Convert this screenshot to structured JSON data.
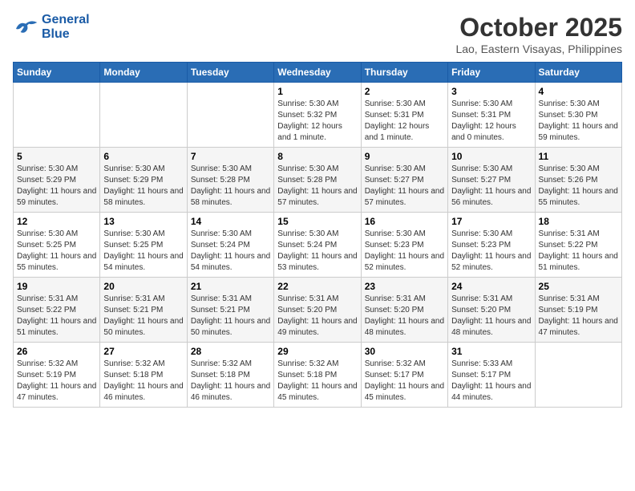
{
  "logo": {
    "line1": "General",
    "line2": "Blue"
  },
  "title": "October 2025",
  "location": "Lao, Eastern Visayas, Philippines",
  "weekdays": [
    "Sunday",
    "Monday",
    "Tuesday",
    "Wednesday",
    "Thursday",
    "Friday",
    "Saturday"
  ],
  "weeks": [
    [
      {
        "day": "",
        "sunrise": "",
        "sunset": "",
        "daylight": ""
      },
      {
        "day": "",
        "sunrise": "",
        "sunset": "",
        "daylight": ""
      },
      {
        "day": "",
        "sunrise": "",
        "sunset": "",
        "daylight": ""
      },
      {
        "day": "1",
        "sunrise": "Sunrise: 5:30 AM",
        "sunset": "Sunset: 5:32 PM",
        "daylight": "Daylight: 12 hours and 1 minute."
      },
      {
        "day": "2",
        "sunrise": "Sunrise: 5:30 AM",
        "sunset": "Sunset: 5:31 PM",
        "daylight": "Daylight: 12 hours and 1 minute."
      },
      {
        "day": "3",
        "sunrise": "Sunrise: 5:30 AM",
        "sunset": "Sunset: 5:31 PM",
        "daylight": "Daylight: 12 hours and 0 minutes."
      },
      {
        "day": "4",
        "sunrise": "Sunrise: 5:30 AM",
        "sunset": "Sunset: 5:30 PM",
        "daylight": "Daylight: 11 hours and 59 minutes."
      }
    ],
    [
      {
        "day": "5",
        "sunrise": "Sunrise: 5:30 AM",
        "sunset": "Sunset: 5:29 PM",
        "daylight": "Daylight: 11 hours and 59 minutes."
      },
      {
        "day": "6",
        "sunrise": "Sunrise: 5:30 AM",
        "sunset": "Sunset: 5:29 PM",
        "daylight": "Daylight: 11 hours and 58 minutes."
      },
      {
        "day": "7",
        "sunrise": "Sunrise: 5:30 AM",
        "sunset": "Sunset: 5:28 PM",
        "daylight": "Daylight: 11 hours and 58 minutes."
      },
      {
        "day": "8",
        "sunrise": "Sunrise: 5:30 AM",
        "sunset": "Sunset: 5:28 PM",
        "daylight": "Daylight: 11 hours and 57 minutes."
      },
      {
        "day": "9",
        "sunrise": "Sunrise: 5:30 AM",
        "sunset": "Sunset: 5:27 PM",
        "daylight": "Daylight: 11 hours and 57 minutes."
      },
      {
        "day": "10",
        "sunrise": "Sunrise: 5:30 AM",
        "sunset": "Sunset: 5:27 PM",
        "daylight": "Daylight: 11 hours and 56 minutes."
      },
      {
        "day": "11",
        "sunrise": "Sunrise: 5:30 AM",
        "sunset": "Sunset: 5:26 PM",
        "daylight": "Daylight: 11 hours and 55 minutes."
      }
    ],
    [
      {
        "day": "12",
        "sunrise": "Sunrise: 5:30 AM",
        "sunset": "Sunset: 5:25 PM",
        "daylight": "Daylight: 11 hours and 55 minutes."
      },
      {
        "day": "13",
        "sunrise": "Sunrise: 5:30 AM",
        "sunset": "Sunset: 5:25 PM",
        "daylight": "Daylight: 11 hours and 54 minutes."
      },
      {
        "day": "14",
        "sunrise": "Sunrise: 5:30 AM",
        "sunset": "Sunset: 5:24 PM",
        "daylight": "Daylight: 11 hours and 54 minutes."
      },
      {
        "day": "15",
        "sunrise": "Sunrise: 5:30 AM",
        "sunset": "Sunset: 5:24 PM",
        "daylight": "Daylight: 11 hours and 53 minutes."
      },
      {
        "day": "16",
        "sunrise": "Sunrise: 5:30 AM",
        "sunset": "Sunset: 5:23 PM",
        "daylight": "Daylight: 11 hours and 52 minutes."
      },
      {
        "day": "17",
        "sunrise": "Sunrise: 5:30 AM",
        "sunset": "Sunset: 5:23 PM",
        "daylight": "Daylight: 11 hours and 52 minutes."
      },
      {
        "day": "18",
        "sunrise": "Sunrise: 5:31 AM",
        "sunset": "Sunset: 5:22 PM",
        "daylight": "Daylight: 11 hours and 51 minutes."
      }
    ],
    [
      {
        "day": "19",
        "sunrise": "Sunrise: 5:31 AM",
        "sunset": "Sunset: 5:22 PM",
        "daylight": "Daylight: 11 hours and 51 minutes."
      },
      {
        "day": "20",
        "sunrise": "Sunrise: 5:31 AM",
        "sunset": "Sunset: 5:21 PM",
        "daylight": "Daylight: 11 hours and 50 minutes."
      },
      {
        "day": "21",
        "sunrise": "Sunrise: 5:31 AM",
        "sunset": "Sunset: 5:21 PM",
        "daylight": "Daylight: 11 hours and 50 minutes."
      },
      {
        "day": "22",
        "sunrise": "Sunrise: 5:31 AM",
        "sunset": "Sunset: 5:20 PM",
        "daylight": "Daylight: 11 hours and 49 minutes."
      },
      {
        "day": "23",
        "sunrise": "Sunrise: 5:31 AM",
        "sunset": "Sunset: 5:20 PM",
        "daylight": "Daylight: 11 hours and 48 minutes."
      },
      {
        "day": "24",
        "sunrise": "Sunrise: 5:31 AM",
        "sunset": "Sunset: 5:20 PM",
        "daylight": "Daylight: 11 hours and 48 minutes."
      },
      {
        "day": "25",
        "sunrise": "Sunrise: 5:31 AM",
        "sunset": "Sunset: 5:19 PM",
        "daylight": "Daylight: 11 hours and 47 minutes."
      }
    ],
    [
      {
        "day": "26",
        "sunrise": "Sunrise: 5:32 AM",
        "sunset": "Sunset: 5:19 PM",
        "daylight": "Daylight: 11 hours and 47 minutes."
      },
      {
        "day": "27",
        "sunrise": "Sunrise: 5:32 AM",
        "sunset": "Sunset: 5:18 PM",
        "daylight": "Daylight: 11 hours and 46 minutes."
      },
      {
        "day": "28",
        "sunrise": "Sunrise: 5:32 AM",
        "sunset": "Sunset: 5:18 PM",
        "daylight": "Daylight: 11 hours and 46 minutes."
      },
      {
        "day": "29",
        "sunrise": "Sunrise: 5:32 AM",
        "sunset": "Sunset: 5:18 PM",
        "daylight": "Daylight: 11 hours and 45 minutes."
      },
      {
        "day": "30",
        "sunrise": "Sunrise: 5:32 AM",
        "sunset": "Sunset: 5:17 PM",
        "daylight": "Daylight: 11 hours and 45 minutes."
      },
      {
        "day": "31",
        "sunrise": "Sunrise: 5:33 AM",
        "sunset": "Sunset: 5:17 PM",
        "daylight": "Daylight: 11 hours and 44 minutes."
      },
      {
        "day": "",
        "sunrise": "",
        "sunset": "",
        "daylight": ""
      }
    ]
  ]
}
